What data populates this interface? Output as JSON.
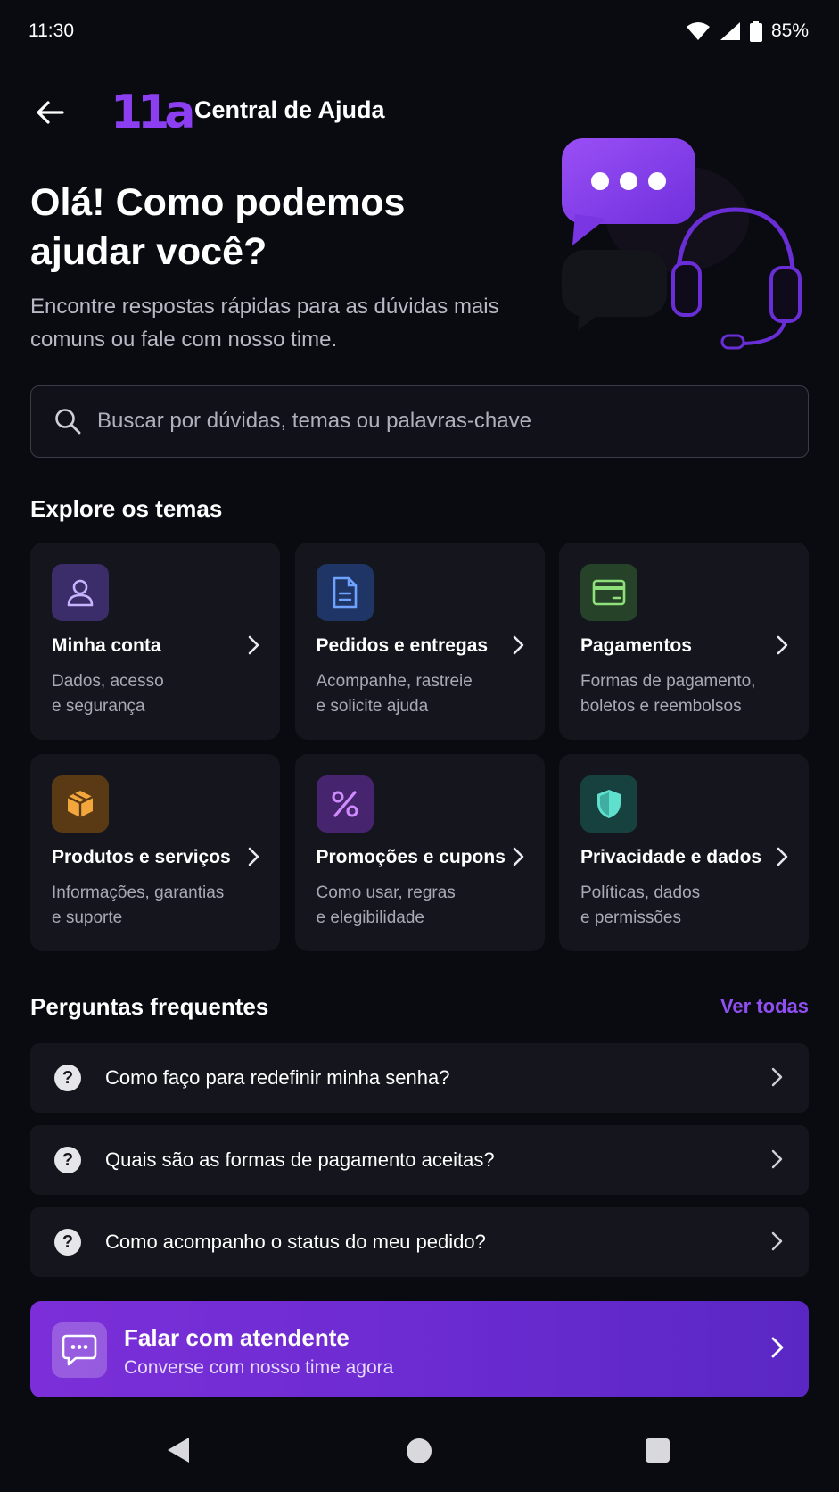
{
  "status_bar": {
    "time": "11:30",
    "battery": "85%"
  },
  "header": {
    "logo": "11a",
    "title": "Central de Ajuda"
  },
  "hero": {
    "title": "Olá! Como podemos ajudar você?",
    "subtitle": "Encontre respostas rápidas para as dúvidas mais comuns ou fale com nosso time."
  },
  "search": {
    "placeholder": "Buscar por dúvidas, temas ou palavras-chave"
  },
  "themes": {
    "title": "Explore os temas",
    "items": [
      {
        "label": "Minha conta",
        "desc_line1": "Dados, acesso",
        "desc_line2": "e segurança",
        "icon": "user-icon",
        "color": "#a98bf0"
      },
      {
        "label": "Pedidos e entregas",
        "desc_line1": "Acompanhe, rastreie",
        "desc_line2": "e solicite ajuda",
        "icon": "document-icon",
        "color": "#5b8fe8"
      },
      {
        "label": "Pagamentos",
        "desc_line1": "Formas de pagamento,",
        "desc_line2": "boletos e reembolsos",
        "icon": "credit-card-icon",
        "color": "#7fd46a"
      },
      {
        "label": "Produtos e serviços",
        "desc_line1": "Informações, garantias",
        "desc_line2": "e suporte",
        "icon": "box-icon",
        "color": "#f0a33a"
      },
      {
        "label": "Promoções e cupons",
        "desc_line1": "Como usar, regras",
        "desc_line2": "e elegibilidade",
        "icon": "percent-icon",
        "color": "#b86cf0"
      },
      {
        "label": "Privacidade e dados",
        "desc_line1": "Políticas, dados",
        "desc_line2": "e permissões",
        "icon": "shield-icon",
        "color": "#4fd1c0"
      }
    ]
  },
  "faq": {
    "title": "Perguntas frequentes",
    "see_all": "Ver todas",
    "items": [
      {
        "question": "Como faço para redefinir minha senha?"
      },
      {
        "question": "Quais são as formas de pagamento aceitas?"
      },
      {
        "question": "Como acompanho o status do meu pedido?"
      }
    ]
  },
  "cta": {
    "title": "Falar com atendente",
    "subtitle": "Converse com nosso time agora"
  },
  "colors": {
    "accent": "#8f4ff2",
    "background": "#0a0b10",
    "card": "#15161d"
  }
}
